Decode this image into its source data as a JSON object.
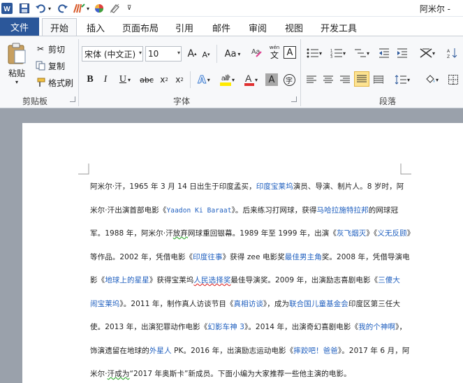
{
  "window": {
    "title": "阿米尔 -"
  },
  "tabs": [
    "文件",
    "开始",
    "插入",
    "页面布局",
    "引用",
    "邮件",
    "审阅",
    "视图",
    "开发工具"
  ],
  "clipboard": {
    "paste": "粘贴",
    "cut": "剪切",
    "copy": "复制",
    "format_painter": "格式刷",
    "group": "剪贴板"
  },
  "font": {
    "name": "宋体 (中文正)",
    "size": "10",
    "case": "Aa",
    "group": "字体",
    "pinyin": "wén"
  },
  "paragraph": {
    "group": "段落"
  },
  "colors": {
    "file_tab": "#2b579a",
    "link": "#1f5fbf",
    "highlight": "#ffea00",
    "font_color": "#e03030"
  },
  "document": {
    "line1": {
      "a": "阿米尔·汗，1965 年 3 月 14 日出生于印度孟买，",
      "b": "印度宝莱坞",
      "c": "演员、导演、制片人。8 岁时，阿"
    },
    "line2": {
      "a": "米尔·汗出演首部电影《",
      "b": "Yaadon Ki Baraat",
      "c": "》。后来练习打网球，获得",
      "d": "马哈拉施特拉邦",
      "e": "的网球冠"
    },
    "line3": {
      "a": "军。1988 年，阿米尔·汗",
      "b": "放弃",
      "c": "网球重回银幕。1989 年至 1999 年，出演《",
      "d": "灰飞烟灭",
      "e": "》《",
      "f": "义无反顾",
      "g": "》"
    },
    "line4": {
      "a": "等作品。2002 年，凭借电影《",
      "b": "印度往事",
      "c": "》获得 zee 电影奖",
      "d": "最佳男主角",
      "e": "奖。2008 年，凭借导演电"
    },
    "line5": {
      "a": "影《",
      "b": "地球上的星星",
      "c": "》获得宝莱坞",
      "d": "人民选择奖",
      "e": "最佳导演奖。2009 年，出演励志喜剧电影《",
      "f": "三傻大"
    },
    "line6": {
      "a": "闹宝莱坞",
      "b": "》。2011 年，制作真人访谈节目《",
      "c": "真相访谈",
      "d": "》，成为",
      "e": "联合国儿童基金会",
      "f": "印度区第三任大"
    },
    "line7": {
      "a": "使。2013 年，出演犯罪动作电影《",
      "b": "幻影车神 3",
      "c": "》。2014 年，出演奇幻喜剧电影《",
      "d": "我的个神啊",
      "e": "》，"
    },
    "line8": {
      "a": "饰演遗留在地球的",
      "b": "外星人",
      "c": " PK。2016 年，出演励志运动电影《",
      "d": "摔跤吧！爸爸",
      "e": "》。2017 年 6 月，阿"
    },
    "line9": {
      "a": "米尔·",
      "b": "汗成为",
      "c": "“2017 年奥斯卡”新成员。下面小编为大家推荐一些他主演的电影。"
    }
  }
}
